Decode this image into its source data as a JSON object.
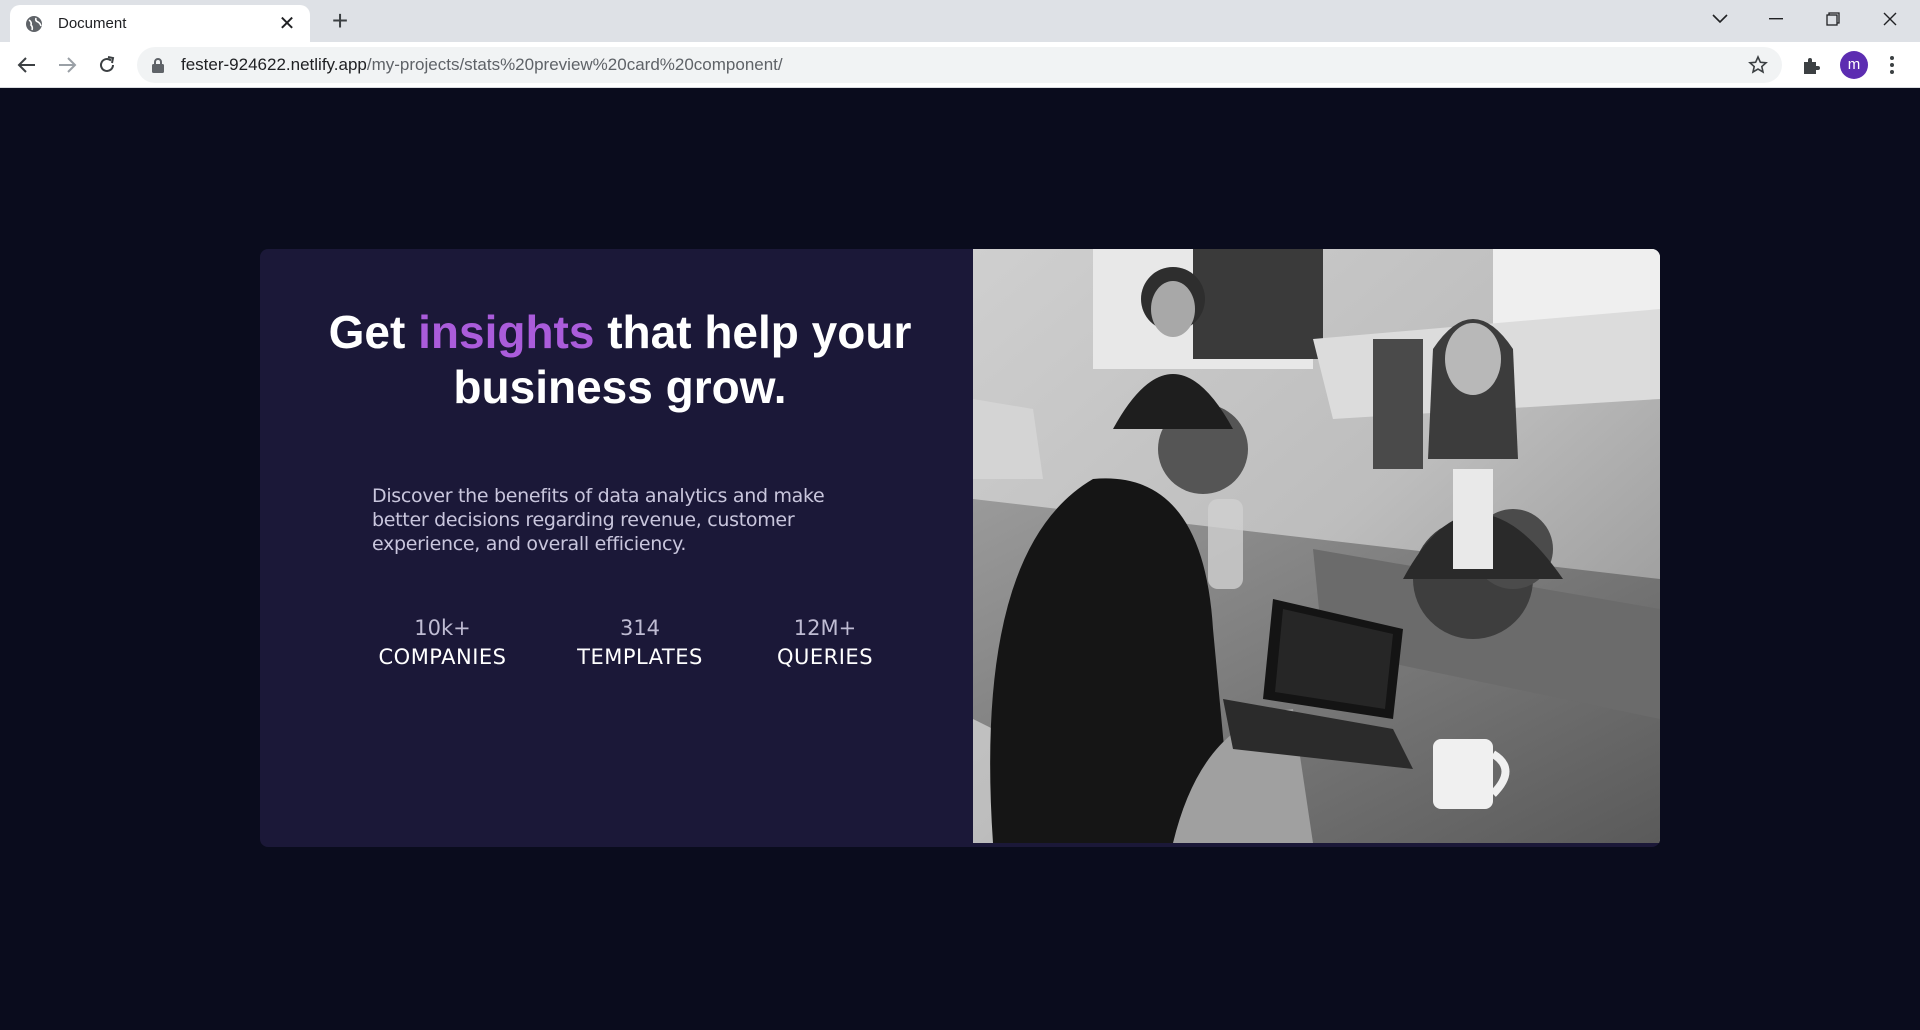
{
  "browser": {
    "tab_title": "Document",
    "url_host": "fester-924622.netlify.app",
    "url_path": "/my-projects/stats%20preview%20card%20component/",
    "profile_initial": "m"
  },
  "card": {
    "headline_pre": "Get ",
    "headline_accent": "insights",
    "headline_post": " that help your business grow.",
    "description": "Discover the benefits of data analytics and make better decisions regarding revenue, customer experience, and overall efficiency.",
    "stats": [
      {
        "value": "10k+",
        "label": "COMPANIES"
      },
      {
        "value": "314",
        "label": "TEMPLATES"
      },
      {
        "value": "12M+",
        "label": "QUERIES"
      }
    ]
  },
  "colors": {
    "page_bg": "#0a0c1d",
    "card_bg": "#1b1838",
    "accent": "#aa5cdb",
    "avatar": "#5c2db1"
  }
}
